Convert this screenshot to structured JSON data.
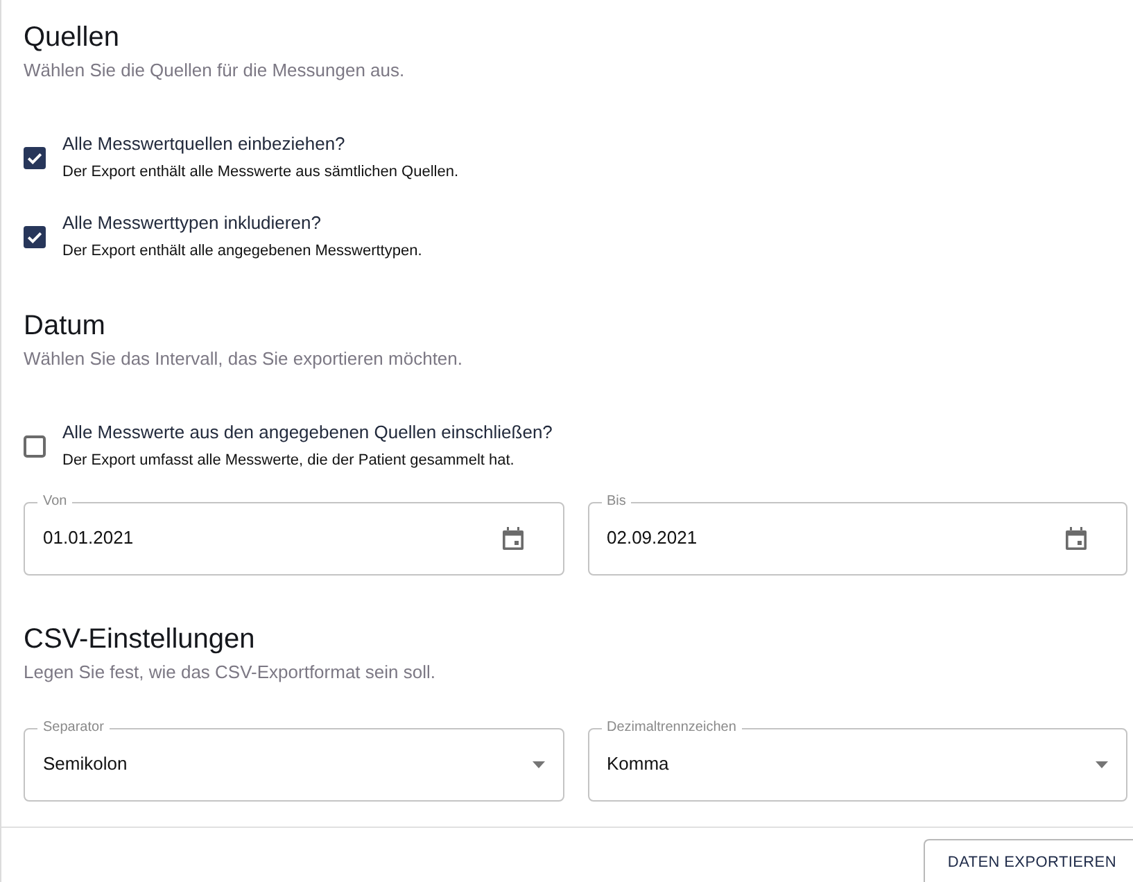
{
  "sections": [
    {
      "title": "Quellen",
      "subtitle": "Wählen Sie die Quellen für die Messungen aus.",
      "options": [
        {
          "label": "Alle Messwertquellen einbeziehen?",
          "description": "Der Export enthält alle Messwerte aus sämtlichen Quellen.",
          "checked": true
        },
        {
          "label": "Alle Messwerttypen inkludieren?",
          "description": "Der Export enthält alle angegebenen Messwerttypen.",
          "checked": true
        }
      ]
    },
    {
      "title": "Datum",
      "subtitle": "Wählen Sie das Intervall, das Sie exportieren möchten.",
      "options": [
        {
          "label": "Alle Messwerte aus den angegebenen Quellen einschließen?",
          "description": "Der Export umfasst alle Messwerte, die der Patient gesammelt hat.",
          "checked": false
        }
      ],
      "fields": [
        {
          "kind": "date",
          "label": "Von",
          "value": "01.01.2021"
        },
        {
          "kind": "date",
          "label": "Bis",
          "value": "02.09.2021"
        }
      ]
    },
    {
      "title": "CSV-Einstellungen",
      "subtitle": "Legen Sie fest, wie das CSV-Exportformat sein soll.",
      "fields": [
        {
          "kind": "select",
          "label": "Separator",
          "value": "Semikolon"
        },
        {
          "kind": "select",
          "label": "Dezimaltrennzeichen",
          "value": "Komma"
        }
      ]
    }
  ],
  "actions": [
    {
      "label": "DATEN EXPORTIEREN"
    }
  ]
}
